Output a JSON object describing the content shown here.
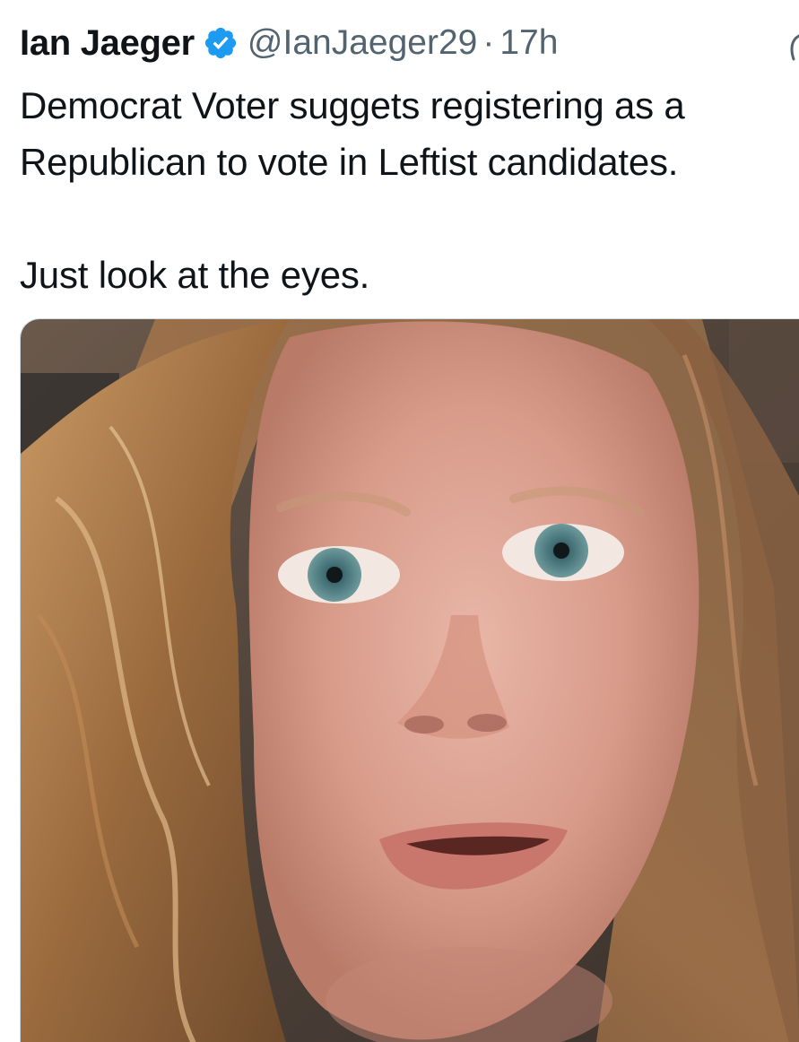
{
  "tweet": {
    "author": {
      "display_name": "Ian Jaeger",
      "handle": "@IanJaeger29",
      "verified": true,
      "verified_icon": "verified-badge-icon",
      "verified_color": "#1d9bf0"
    },
    "separator": "·",
    "timestamp": "17h",
    "text": "Democrat Voter suggets registering as a\nRepublican to vote in Leftist candidates.\n\nJust look at the eyes.",
    "media": {
      "type": "video-thumbnail",
      "icon": "photo-icon"
    },
    "more_icon": "more-icon"
  },
  "colors": {
    "text_primary": "#0f1419",
    "text_secondary": "#536471",
    "accent": "#1d9bf0",
    "background": "#ffffff"
  }
}
